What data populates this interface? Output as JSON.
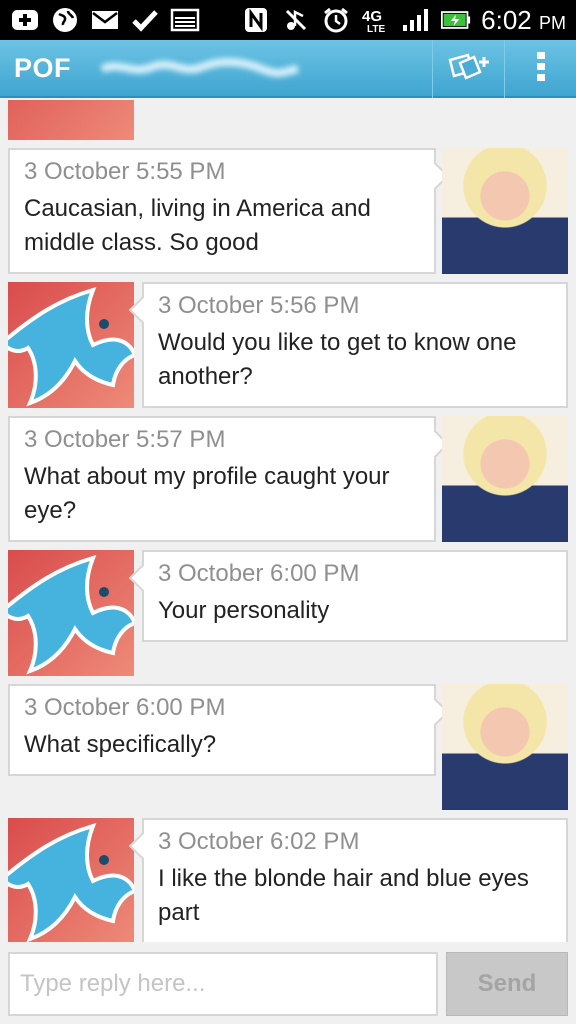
{
  "status_bar": {
    "time": "6:02",
    "ampm": "PM",
    "network": "4G LTE",
    "left_icons": [
      "add-icon",
      "globe-icon",
      "mail-icon",
      "check-icon",
      "image-icon"
    ],
    "right_icons": [
      "nfc-icon",
      "mute-icon",
      "alarm-icon",
      "4g-lte-icon",
      "signal-icon",
      "battery-charging-icon"
    ]
  },
  "app_bar": {
    "logo": "POF",
    "username": "",
    "actions": [
      "add-photo-icon",
      "overflow-menu-icon"
    ]
  },
  "messages": [
    {
      "from": "her",
      "stamp": "3 October 5:55 PM",
      "text": "Caucasian, living in America and middle class. So good"
    },
    {
      "from": "me",
      "stamp": "3 October 5:56 PM",
      "text": "Would you like to get to know one another?"
    },
    {
      "from": "her",
      "stamp": "3 October 5:57 PM",
      "text": "What about my profile caught your eye?"
    },
    {
      "from": "me",
      "stamp": "3 October 6:00 PM",
      "text": "Your personality"
    },
    {
      "from": "her",
      "stamp": "3 October 6:00 PM",
      "text": "What specifically?"
    },
    {
      "from": "me",
      "stamp": "3 October 6:02 PM",
      "text": "I like the blonde hair and blue eyes part"
    }
  ],
  "composer": {
    "placeholder": "Type reply here...",
    "value": "",
    "send_label": "Send"
  },
  "colors": {
    "app_bar": "#48acd6",
    "fish": "#46b3de",
    "background": "#f0f0f0"
  }
}
